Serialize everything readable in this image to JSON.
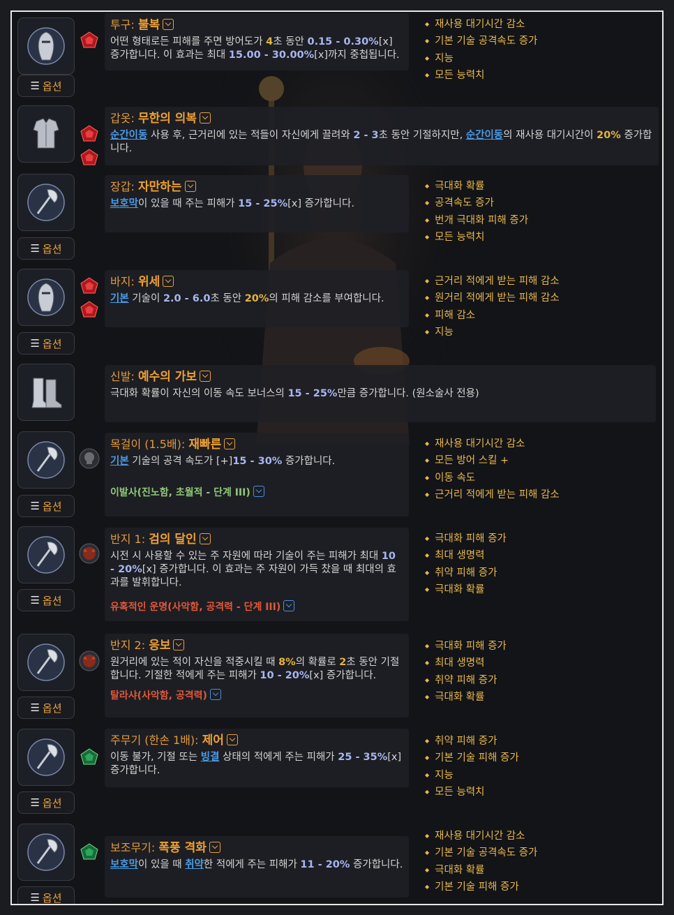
{
  "ui": {
    "option_label": "옵션"
  },
  "items": [
    {
      "slot": "투구",
      "name": "불복",
      "desc_parts": [
        {
          "t": "어떤 형태로든 피해를 주면 방어도가 "
        },
        {
          "t": "4",
          "c": "hl2"
        },
        {
          "t": "초 동안 "
        },
        {
          "t": "0.15 - 0.30%",
          "c": "hl"
        },
        {
          "t": "[x] 증가합니다. 이 효과는 최대 "
        },
        {
          "t": "15.00 - 30.00%",
          "c": "hl"
        },
        {
          "t": "[x]까지 중첩됩니다."
        }
      ],
      "stats": [
        "재사용 대기시간 감소",
        "기본 기술 공격속도 증가",
        "지능",
        "모든 능력치"
      ]
    },
    {
      "slot": "갑옷",
      "name": "무한의 의복",
      "desc_parts": [
        {
          "t": "순간이동",
          "c": "kw"
        },
        {
          "t": " 사용 후, 근거리에 있는 적들이 자신에게 끌려와 "
        },
        {
          "t": "2 - 3",
          "c": "hl"
        },
        {
          "t": "초 동안 기절하지만, "
        },
        {
          "t": "순간이동",
          "c": "kw"
        },
        {
          "t": "의 재사용 대기시간이 "
        },
        {
          "t": "20%",
          "c": "hl2"
        },
        {
          "t": " 증가합니다."
        }
      ],
      "stats": []
    },
    {
      "slot": "장갑",
      "name": "자만하는",
      "desc_parts": [
        {
          "t": "보호막",
          "c": "kw"
        },
        {
          "t": "이 있을 때 주는 피해가 "
        },
        {
          "t": "15 - 25%",
          "c": "hl"
        },
        {
          "t": "[x] 증가합니다."
        }
      ],
      "stats": [
        "극대화 확률",
        "공격속도 증가",
        "번개 극대화 피해 증가",
        "모든 능력치"
      ]
    },
    {
      "slot": "바지",
      "name": "위세",
      "desc_parts": [
        {
          "t": "기본",
          "c": "kw"
        },
        {
          "t": " 기술이 "
        },
        {
          "t": "2.0 - 6.0",
          "c": "hl"
        },
        {
          "t": "초 동안 "
        },
        {
          "t": "20%",
          "c": "hl2"
        },
        {
          "t": "의 피해 감소를 부여합니다."
        }
      ],
      "stats": [
        "근거리 적에게 받는 피해 감소",
        "원거리 적에게 받는 피해 감소",
        "피해 감소",
        "지능"
      ]
    },
    {
      "slot": "신발",
      "name": "예수의 가보",
      "desc_parts": [
        {
          "t": "극대화 확률이 자신의 이동 속도 보너스의 "
        },
        {
          "t": "15 - 25%",
          "c": "hl"
        },
        {
          "t": "만큼 증가합니다. (원소술사 전용)"
        }
      ],
      "stats": []
    },
    {
      "slot": "목걸이 (1.5배)",
      "name": "재빠른",
      "desc_parts": [
        {
          "t": "기본",
          "c": "kw"
        },
        {
          "t": " 기술의 공격 속도가 [+]"
        },
        {
          "t": "15 - 30%",
          "c": "hl"
        },
        {
          "t": " 증가합니다."
        }
      ],
      "aspect": "이발사(진노함, 초월적 - 단계 III)",
      "stats": [
        "재사용 대기시간 감소",
        "모든 방어 스킬 +",
        "이동 속도",
        "근거리 적에게 받는 피해 감소"
      ]
    },
    {
      "slot": "반지 1",
      "name": "검의 달인",
      "desc_parts": [
        {
          "t": "시전 시 사용할 수 있는 주 자원에 따라 기술이 주는 피해가 최대 "
        },
        {
          "t": "10 - 20%",
          "c": "hl"
        },
        {
          "t": "[x] 증가합니다. 이 효과는 주 자원이 가득 찼을 때 최대의 효과를 발휘합니다."
        }
      ],
      "aspect": "유혹적인 운명(사악함, 공격력 - 단계 III)",
      "stats": [
        "극대화 피해 증가",
        "최대 생명력",
        "취약 피해 증가",
        "극대화 확률"
      ]
    },
    {
      "slot": "반지 2",
      "name": "응보",
      "desc_parts": [
        {
          "t": "원거리에 있는 적이 자신을 적중시킬 때 "
        },
        {
          "t": "8%",
          "c": "hl2"
        },
        {
          "t": "의 확률로 "
        },
        {
          "t": "2",
          "c": "hl2"
        },
        {
          "t": "초 동안 기절합니다. 기절한 적에게 주는 피해가 "
        },
        {
          "t": "10 - 20%",
          "c": "hl"
        },
        {
          "t": "[x] 증가합니다."
        }
      ],
      "aspect": "탈라샤(사악함, 공격력)",
      "stats": [
        "극대화 피해 증가",
        "최대 생명력",
        "취약 피해 증가",
        "극대화 확률"
      ]
    },
    {
      "slot": "주무기 (한손 1배)",
      "name": "제어",
      "desc_parts": [
        {
          "t": "이동 불가, 기절 또는 "
        },
        {
          "t": "빙결",
          "c": "kw"
        },
        {
          "t": " 상태의 적에게 주는 피해가 "
        },
        {
          "t": "25 - 35%",
          "c": "hl"
        },
        {
          "t": "[x] 증가합니다."
        }
      ],
      "stats": [
        "취약 피해 증가",
        "기본 기술 피해 증가",
        "지능",
        "모든 능력치"
      ]
    },
    {
      "slot": "보조무기",
      "name": "폭풍 격화",
      "desc_parts": [
        {
          "t": "보호막",
          "c": "kw"
        },
        {
          "t": "이 있을 때 "
        },
        {
          "t": "취약",
          "c": "kw"
        },
        {
          "t": "한 적에게 주는 피해가 "
        },
        {
          "t": "11 - 20%",
          "c": "hl"
        },
        {
          "t": " 증가합니다."
        }
      ],
      "stats": [
        "재사용 대기시간 감소",
        "기본 기술 공격속도 증가",
        "극대화 확률",
        "기본 기술 피해 증가"
      ]
    }
  ]
}
